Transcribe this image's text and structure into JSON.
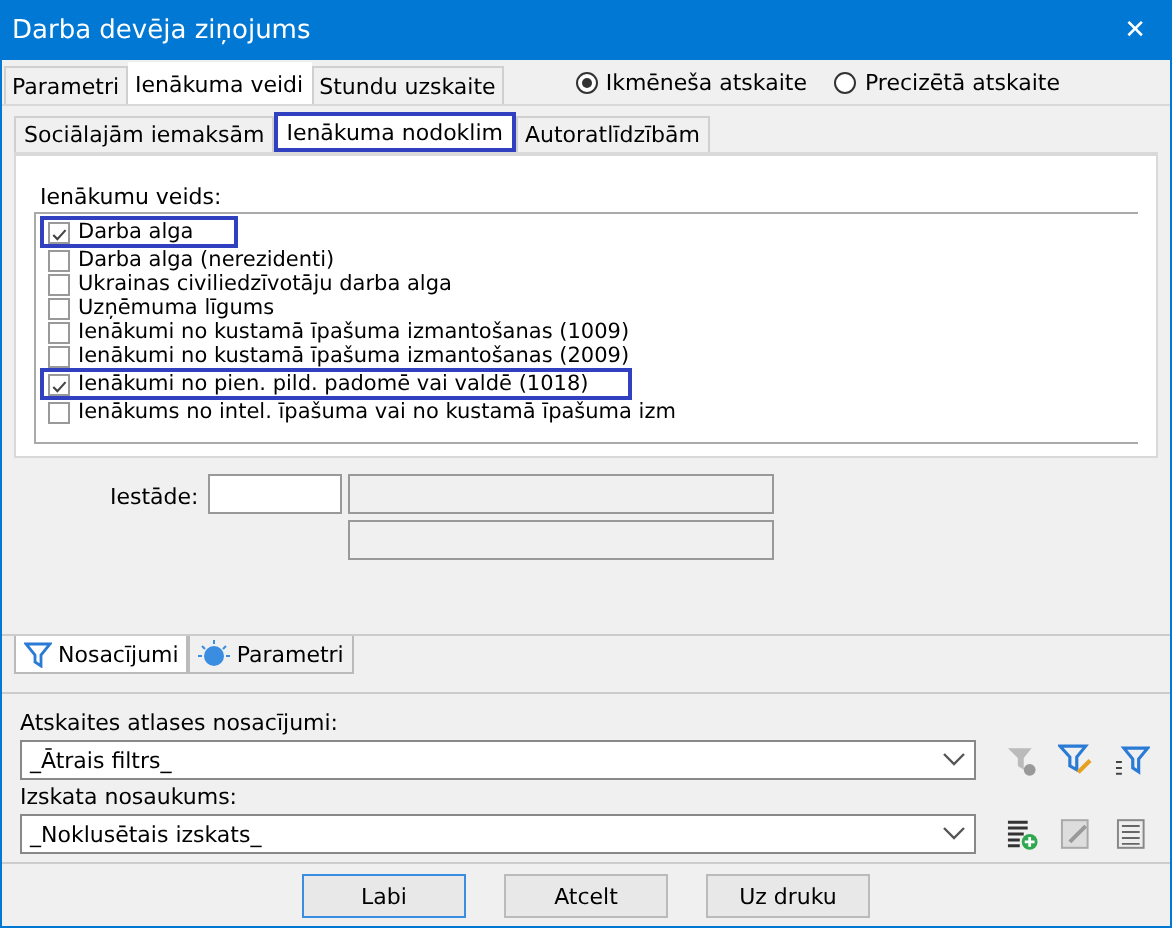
{
  "window": {
    "title": "Darba devēja ziņojums",
    "close": "✕"
  },
  "tabs": [
    {
      "label": "Parametri",
      "selected": false
    },
    {
      "label": "Ienākuma veidi",
      "selected": true
    },
    {
      "label": "Stundu uzskaite",
      "selected": false
    }
  ],
  "report_type": [
    {
      "label": "Ikmēneša atskaite",
      "selected": true
    },
    {
      "label": "Precizētā atskaite",
      "selected": false
    }
  ],
  "subtabs": [
    {
      "label": "Sociālajām iemaksām",
      "selected": false,
      "highlighted": false
    },
    {
      "label": "Ienākuma nodoklim",
      "selected": true,
      "highlighted": true
    },
    {
      "label": "Autoratlīdzībām",
      "selected": false,
      "highlighted": false
    }
  ],
  "income_types": {
    "label": "Ienākumu veids:",
    "items": [
      {
        "label": "Darba alga",
        "checked": true,
        "highlighted": true
      },
      {
        "label": "Darba alga (nerezidenti)",
        "checked": false,
        "highlighted": false
      },
      {
        "label": "Ukrainas civiliedzīvotāju darba alga",
        "checked": false,
        "highlighted": false
      },
      {
        "label": "Uzņēmuma līgums",
        "checked": false,
        "highlighted": false
      },
      {
        "label": "Ienākumi no kustamā īpašuma izmantošanas (1009)",
        "checked": false,
        "highlighted": false
      },
      {
        "label": "Ienākumi no kustamā īpašuma izmantošanas (2009)",
        "checked": false,
        "highlighted": false
      },
      {
        "label": "Ienākumi no pien. pild. padomē vai valdē (1018)",
        "checked": true,
        "highlighted": true
      },
      {
        "label": "Ienākums no intel. īpašuma vai no kustamā īpašuma izm",
        "checked": false,
        "highlighted": false
      }
    ]
  },
  "institution": {
    "label": "Iestāde:"
  },
  "bottom_tabs": [
    {
      "label": "Nosacījumi",
      "selected": true,
      "kind": "filter"
    },
    {
      "label": "Parametri",
      "selected": false,
      "kind": "params"
    }
  ],
  "conditions": {
    "label": "Atskaites atlases nosacījumi:",
    "value": "_Ātrais filtrs_"
  },
  "view": {
    "label": "Izskata nosaukums:",
    "value": "_Noklusētais izskats_"
  },
  "buttons": [
    {
      "label": "Labi",
      "selected": true
    },
    {
      "label": "Atcelt",
      "selected": false
    },
    {
      "label": "Uz druku",
      "selected": false
    }
  ]
}
